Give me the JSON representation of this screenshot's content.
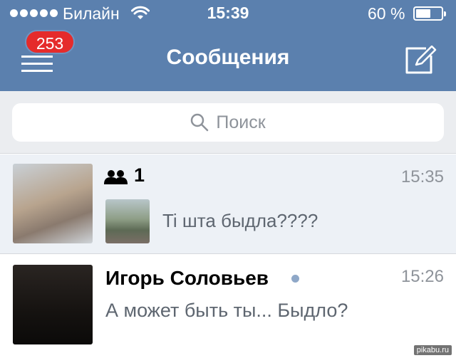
{
  "status_bar": {
    "carrier": "Билайн",
    "time": "15:39",
    "battery": "60 %",
    "battery_level": 0.6,
    "signal_bars": 5
  },
  "nav": {
    "title": "Сообщения",
    "badge": "253",
    "menu_icon": "hamburger-icon",
    "compose_icon": "compose-icon",
    "color": "#5b80ae"
  },
  "search": {
    "placeholder": "Поиск",
    "icon": "search-icon"
  },
  "dialogs": [
    {
      "type": "group",
      "members_count": "1",
      "time": "15:35",
      "message": "Ti шта быдла????"
    },
    {
      "type": "user",
      "name": "Игорь Соловьев",
      "online": true,
      "time": "15:26",
      "message": "А может быть ты... Быдло?"
    }
  ],
  "watermark": "pikabu.ru",
  "colors": {
    "accent": "#5b80ae",
    "badge": "#e52b2b",
    "muted_text": "#8e939a",
    "unread_row": "#edf1f6"
  }
}
